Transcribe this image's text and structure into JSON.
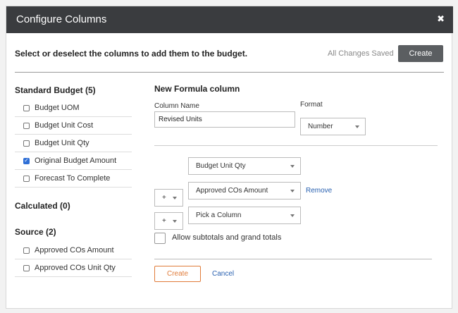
{
  "window": {
    "title": "Configure Columns"
  },
  "header": {
    "instructions": "Select or deselect the columns to add them to the budget.",
    "saved_status": "All Changes Saved",
    "create_label": "Create"
  },
  "standard_budget": {
    "title": "Standard Budget (5)",
    "items": [
      {
        "label": "Budget UOM",
        "checked": false
      },
      {
        "label": "Budget Unit Cost",
        "checked": false
      },
      {
        "label": "Budget Unit Qty",
        "checked": false
      },
      {
        "label": "Original Budget Amount",
        "checked": true
      },
      {
        "label": "Forecast To Complete",
        "checked": false
      }
    ]
  },
  "calculated": {
    "title": "Calculated (0)"
  },
  "source": {
    "title": "Source (2)",
    "items": [
      {
        "label": "Approved COs Amount",
        "checked": false
      },
      {
        "label": "Approved COs Unit Qty",
        "checked": false
      }
    ]
  },
  "formula": {
    "title": "New Formula column",
    "column_name_label": "Column Name",
    "column_name_value": "Revised Units",
    "format_label": "Format",
    "format_value": "Number",
    "operand1": "Budget Unit Qty",
    "operator1": "+",
    "operand2": "Approved COs Amount",
    "remove_label": "Remove",
    "operator2": "+",
    "operand3": "Pick a Column",
    "subtotals_label": "Allow subtotals and grand totals",
    "create_label": "Create",
    "cancel_label": "Cancel"
  },
  "icons": {
    "close": "close-icon",
    "check": "check-icon",
    "caret": "chevron-down-icon"
  }
}
